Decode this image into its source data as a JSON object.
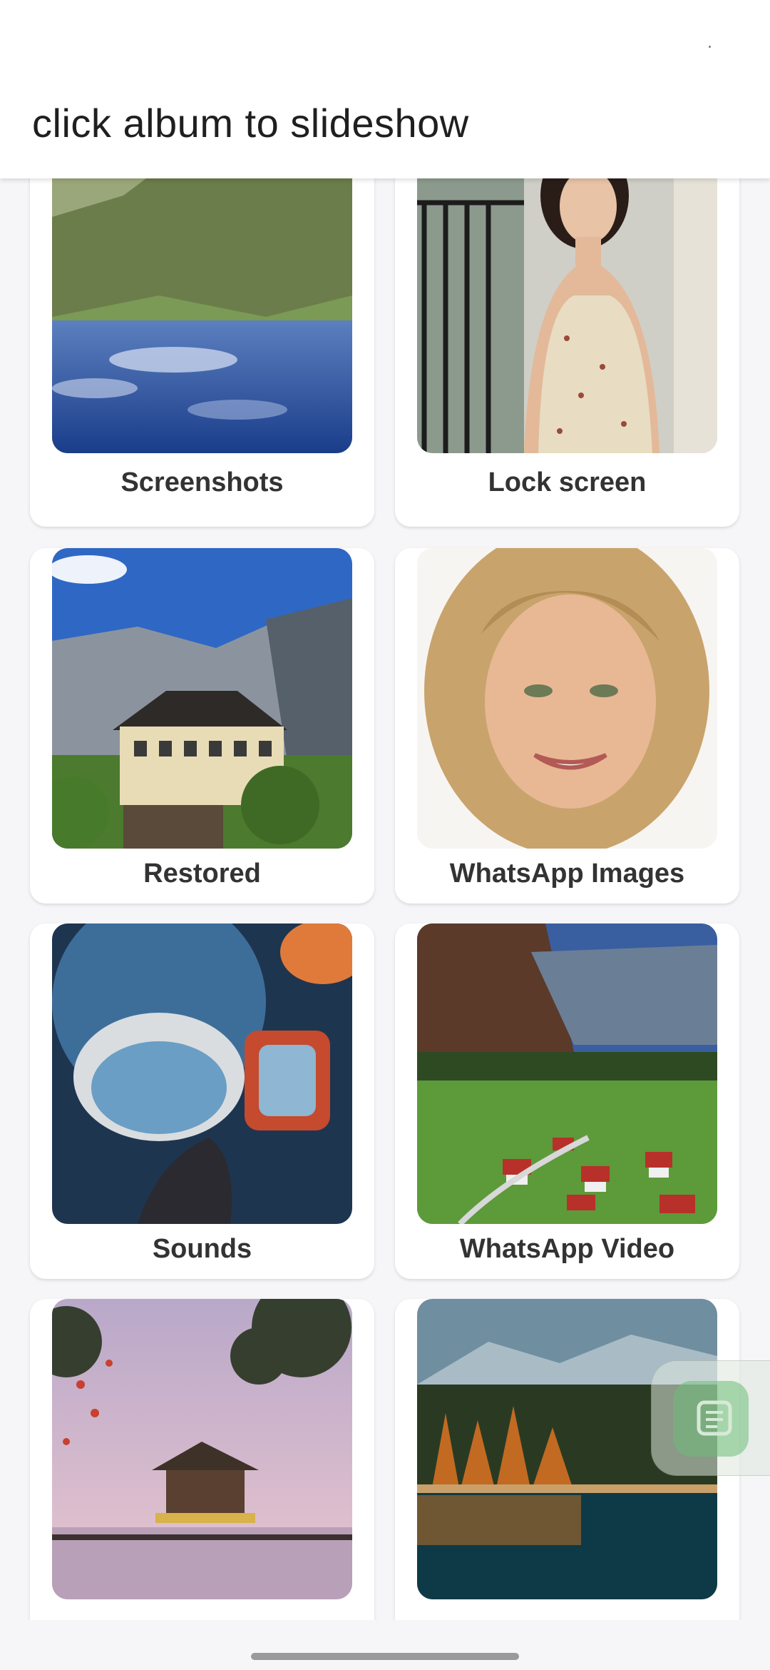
{
  "header": {
    "title": "click album to slideshow"
  },
  "albums": [
    {
      "label": "Screenshots",
      "image": "lake-mountain-reflection"
    },
    {
      "label": "Lock screen",
      "image": "woman-floral-dress"
    },
    {
      "label": "Restored",
      "image": "alpine-house-cliffs"
    },
    {
      "label": "WhatsApp Images",
      "image": "blonde-woman-portrait"
    },
    {
      "label": "Sounds",
      "image": "vr-headset-surreal-art"
    },
    {
      "label": "WhatsApp Video",
      "image": "valley-village"
    },
    {
      "label": "",
      "image": "lake-pavilion-blossoms"
    },
    {
      "label": "",
      "image": "autumn-forest-lake"
    }
  ],
  "floating_button": {
    "icon": "chat-note-icon"
  }
}
